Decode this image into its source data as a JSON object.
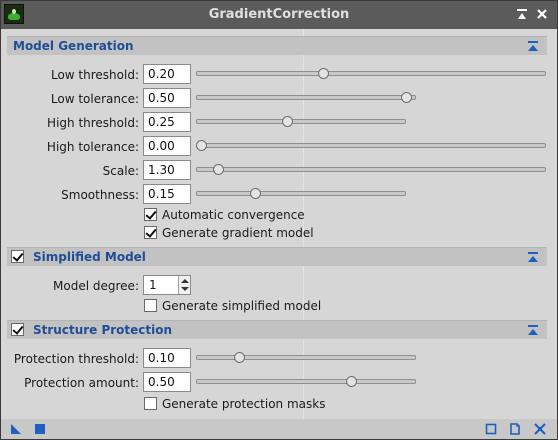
{
  "window": {
    "title": "GradientCorrection"
  },
  "model_generation": {
    "title": "Model Generation",
    "params": [
      {
        "label": "Low threshold:",
        "value": "0.20",
        "slider": 0.36
      },
      {
        "label": "Low tolerance:",
        "value": "0.50",
        "slider": 0.98
      },
      {
        "label": "High threshold:",
        "value": "0.25",
        "slider": 0.43
      },
      {
        "label": "High tolerance:",
        "value": "0.00",
        "slider": 0.0
      },
      {
        "label": "Scale:",
        "value": "1.30",
        "slider": 0.05
      },
      {
        "label": "Smoothness:",
        "value": "0.15",
        "slider": 0.27
      }
    ],
    "checkboxes": [
      {
        "label": "Automatic convergence",
        "checked": true
      },
      {
        "label": "Generate gradient model",
        "checked": true
      }
    ]
  },
  "simplified_model": {
    "title": "Simplified Model",
    "enabled": true,
    "degree_label": "Model degree:",
    "degree_value": "1",
    "checkbox": {
      "label": "Generate simplified model",
      "checked": false
    }
  },
  "structure_protection": {
    "title": "Structure Protection",
    "enabled": true,
    "params": [
      {
        "label": "Protection threshold:",
        "value": "0.10",
        "slider": 0.18
      },
      {
        "label": "Protection amount:",
        "value": "0.50",
        "slider": 0.72
      }
    ],
    "checkbox": {
      "label": "Generate protection masks",
      "checked": false
    }
  },
  "icons": {
    "app": "gradient-correction-app-icon",
    "shade": "shade-icon",
    "close": "close-icon",
    "collapse": "collapse-section-icon",
    "new_instance": "new-instance-icon",
    "apply": "apply-global-icon",
    "preview": "preview-icon",
    "browse_doc": "browse-documentation-icon",
    "reset": "reset-icon"
  },
  "colors": {
    "section_title": "#1f4e96",
    "accent_blue": "#1f5fbf"
  }
}
